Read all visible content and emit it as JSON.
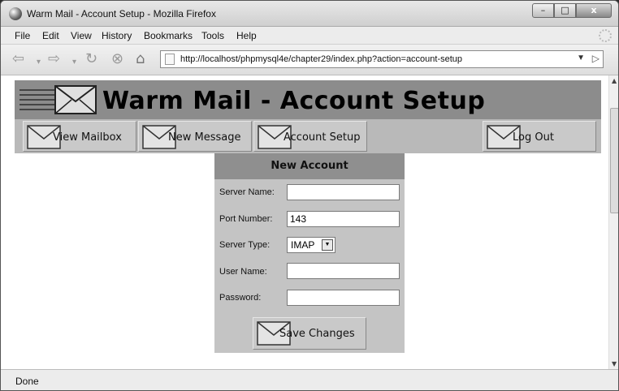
{
  "window": {
    "title": "Warm Mail - Account Setup - Mozilla Firefox",
    "controls": {
      "minimize": "–",
      "maximize": "□",
      "close": "x"
    }
  },
  "menu": [
    "File",
    "Edit",
    "View",
    "History",
    "Bookmarks",
    "Tools",
    "Help"
  ],
  "address": {
    "url": "http://localhost/phpmysql4e/chapter29/index.php?action=account-setup"
  },
  "page": {
    "title": "Warm Mail - Account Setup",
    "nav": {
      "view_mailbox": "View Mailbox",
      "new_message": "New Message",
      "account_setup": "Account Setup",
      "log_out": "Log Out"
    },
    "form": {
      "heading": "New Account",
      "server_name_label": "Server Name:",
      "server_name_value": "",
      "port_label": "Port Number:",
      "port_value": "143",
      "server_type_label": "Server Type:",
      "server_type_value": "IMAP",
      "user_name_label": "User Name:",
      "user_name_value": "",
      "password_label": "Password:",
      "password_value": "",
      "save_label": "Save Changes"
    }
  },
  "status": {
    "text": "Done"
  }
}
